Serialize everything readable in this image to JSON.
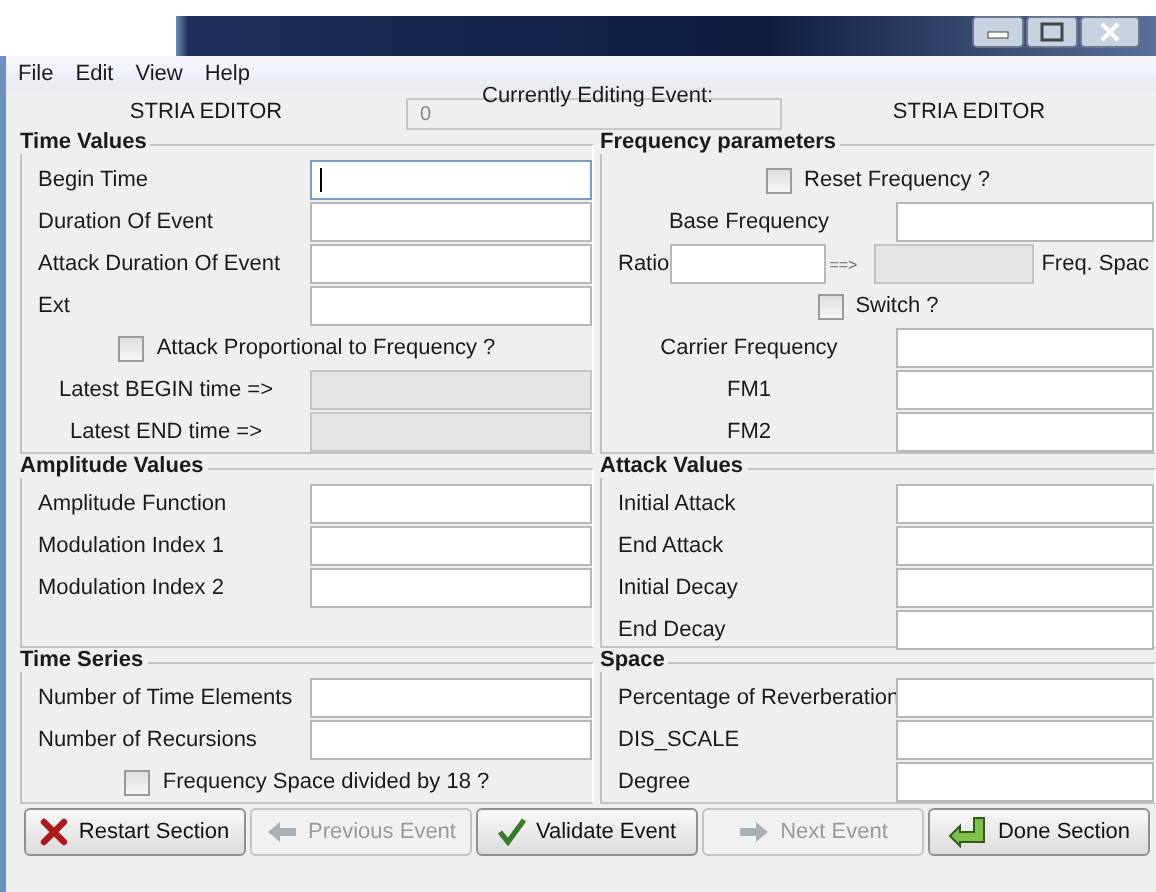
{
  "menu": [
    {
      "label": "File"
    },
    {
      "label": "Edit"
    },
    {
      "label": "View"
    },
    {
      "label": "Help"
    }
  ],
  "header": {
    "caption": "Currently Editing Event:",
    "left_title": "STRIA EDITOR",
    "event_field": {
      "value": "0",
      "disabled": true
    },
    "right_title": "STRIA EDITOR"
  },
  "section_rows": [
    [
      {
        "title": "Time Values",
        "rows": [
          {
            "kind": "field",
            "label": "Begin Time",
            "focused": true,
            "disabled": false
          },
          {
            "kind": "field",
            "label": "Duration Of Event",
            "focused": false,
            "disabled": false
          },
          {
            "kind": "field",
            "label": "Attack Duration Of Event",
            "focused": false,
            "disabled": false
          },
          {
            "kind": "field",
            "label": "Ext",
            "focused": false,
            "disabled": false
          },
          {
            "kind": "checkbox",
            "label": "Attack Proportional to Frequency ?",
            "checked": false
          },
          {
            "kind": "field",
            "label": "Latest BEGIN time =>",
            "focused": false,
            "disabled": true
          },
          {
            "kind": "field",
            "label": "Latest END time =>",
            "focused": false,
            "disabled": true
          }
        ]
      },
      {
        "title": "Frequency parameters",
        "rows": [
          {
            "kind": "checkbox",
            "label": "Reset Frequency ?",
            "checked": false
          },
          {
            "kind": "field",
            "label": "Base Frequency",
            "focused": false,
            "disabled": false
          },
          {
            "kind": "ratio",
            "label": "Ratio",
            "arrow": "==>",
            "suffix": "Freq. Spac"
          },
          {
            "kind": "checkbox",
            "label": "Switch ?",
            "checked": false
          },
          {
            "kind": "field",
            "label": "Carrier Frequency",
            "focused": false,
            "disabled": false
          },
          {
            "kind": "field",
            "label": "FM1",
            "focused": false,
            "disabled": false
          },
          {
            "kind": "field",
            "label": "FM2",
            "focused": false,
            "disabled": false
          }
        ]
      }
    ],
    [
      {
        "title": "Amplitude Values",
        "rows": [
          {
            "kind": "field",
            "label": "Amplitude Function",
            "focused": false,
            "disabled": false
          },
          {
            "kind": "field",
            "label": "Modulation Index 1",
            "focused": false,
            "disabled": false
          },
          {
            "kind": "field",
            "label": "Modulation Index 2",
            "focused": false,
            "disabled": false
          }
        ]
      },
      {
        "title": "Attack Values",
        "rows": [
          {
            "kind": "field",
            "label": "Initial Attack",
            "focused": false,
            "disabled": false
          },
          {
            "kind": "field",
            "label": "End Attack",
            "focused": false,
            "disabled": false
          },
          {
            "kind": "field",
            "label": "Initial Decay",
            "focused": false,
            "disabled": false
          },
          {
            "kind": "field",
            "label": "End Decay",
            "focused": false,
            "disabled": false
          }
        ]
      }
    ],
    [
      {
        "title": "Time Series",
        "rows": [
          {
            "kind": "field",
            "label": "Number of Time Elements",
            "focused": false,
            "disabled": false
          },
          {
            "kind": "field",
            "label": "Number of Recursions",
            "focused": false,
            "disabled": false
          },
          {
            "kind": "checkbox",
            "label": "Frequency Space divided by 18 ?",
            "checked": false
          }
        ]
      },
      {
        "title": "Space",
        "rows": [
          {
            "kind": "field",
            "label": "Percentage of Reverberation",
            "focused": false,
            "disabled": false
          },
          {
            "kind": "field",
            "label": "DIS_SCALE",
            "focused": false,
            "disabled": false
          },
          {
            "kind": "field",
            "label": "Degree",
            "focused": false,
            "disabled": false
          }
        ]
      }
    ]
  ],
  "buttons": [
    {
      "label": "Restart Section",
      "disabled": false
    },
    {
      "label": "Previous Event",
      "disabled": true
    },
    {
      "label": "Validate Event",
      "disabled": false
    },
    {
      "label": "Next Event",
      "disabled": true
    },
    {
      "label": "Done Section",
      "disabled": false
    }
  ]
}
